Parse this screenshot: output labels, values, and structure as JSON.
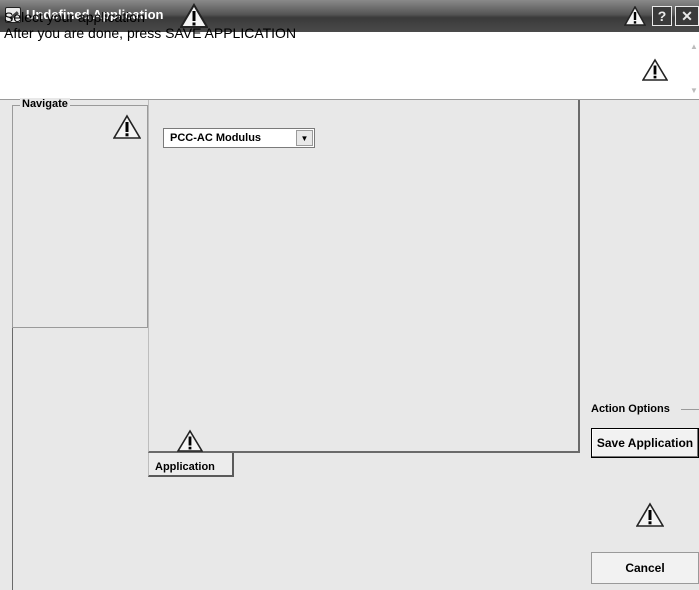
{
  "window": {
    "title": "Undefined Application",
    "help_label": "?",
    "close_label": "✕"
  },
  "instructions": {
    "line1": "Select your application",
    "line2": "After you are done, press SAVE APPLICATION"
  },
  "navigate": {
    "label": "Navigate"
  },
  "main": {
    "application_select": {
      "selected": "PCC-AC Modulus"
    },
    "tabs": [
      {
        "label": "Application"
      }
    ]
  },
  "actions": {
    "label": "Action Options",
    "save_label": "Save Application",
    "cancel_label": "Cancel"
  },
  "icons": {
    "warning": "warning-icon",
    "app": "app-icon"
  }
}
